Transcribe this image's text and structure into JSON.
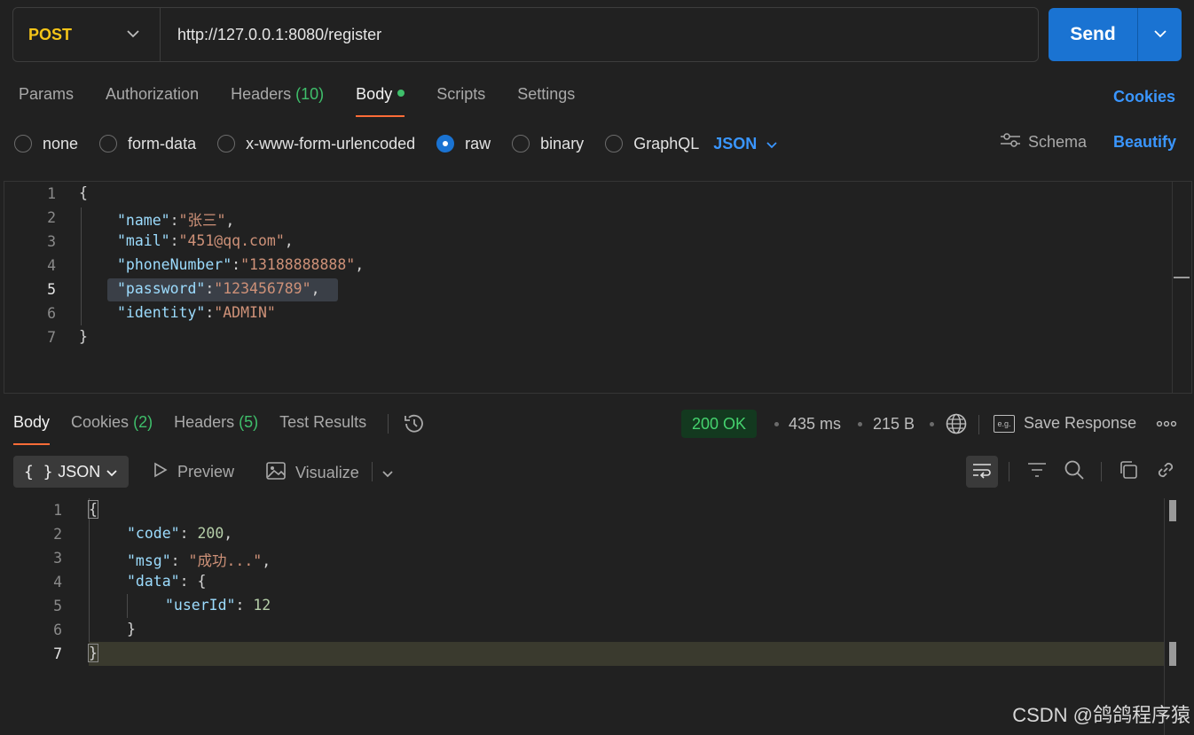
{
  "request": {
    "method": "POST",
    "url": "http://127.0.0.1:8080/register",
    "send_label": "Send"
  },
  "request_tabs": [
    {
      "label": "Params"
    },
    {
      "label": "Authorization"
    },
    {
      "label": "Headers",
      "count": "(10)"
    },
    {
      "label": "Body"
    },
    {
      "label": "Scripts"
    },
    {
      "label": "Settings"
    }
  ],
  "cookies_label": "Cookies",
  "body_types": [
    "none",
    "form-data",
    "x-www-form-urlencoded",
    "raw",
    "binary",
    "GraphQL"
  ],
  "body_type_selected": "raw",
  "body_language": "JSON",
  "schema_label": "Schema",
  "beautify_label": "Beautify",
  "request_body": {
    "line_numbers": [
      "1",
      "2",
      "3",
      "4",
      "5",
      "6",
      "7"
    ],
    "open_brace": "{",
    "close_brace": "}",
    "fields": [
      {
        "key": "\"name\"",
        "value": "\"张三\"",
        "comma": ","
      },
      {
        "key": "\"mail\"",
        "value": "\"451@qq.com\"",
        "comma": ","
      },
      {
        "key": "\"phoneNumber\"",
        "value": "\"13188888888\"",
        "comma": ","
      },
      {
        "key": "\"password\"",
        "value": "\"123456789\"",
        "comma": ","
      },
      {
        "key": "\"identity\"",
        "value": "\"ADMIN\"",
        "comma": ""
      }
    ]
  },
  "response_tabs": [
    {
      "label": "Body"
    },
    {
      "label": "Cookies",
      "count": "(2)"
    },
    {
      "label": "Headers",
      "count": "(5)"
    },
    {
      "label": "Test Results"
    }
  ],
  "response_status": "200 OK",
  "response_time": "435 ms",
  "response_size": "215 B",
  "save_response_label": "Save Response",
  "save_response_icon_text": "e.g.",
  "response_view": {
    "format": "JSON",
    "format_icon": "{ }",
    "preview_label": "Preview",
    "visualize_label": "Visualize"
  },
  "response_body": {
    "line_numbers": [
      "1",
      "2",
      "3",
      "4",
      "5",
      "6",
      "7"
    ],
    "l1": "{",
    "code_key": "\"code\"",
    "code_value": "200",
    "msg_key": "\"msg\"",
    "msg_value": "\"成功...\"",
    "data_key": "\"data\"",
    "data_open": "{",
    "userid_key": "\"userId\"",
    "userid_value": "12",
    "data_close": "}",
    "l7": "}"
  },
  "watermark": "CSDN @鸽鸽程序猿",
  "colors": {
    "accent_orange": "#ff6c37",
    "send_blue": "#1a73d2",
    "link_blue": "#3a96ff",
    "method_yellow": "#f5c518",
    "status_green": "#45d26e"
  }
}
